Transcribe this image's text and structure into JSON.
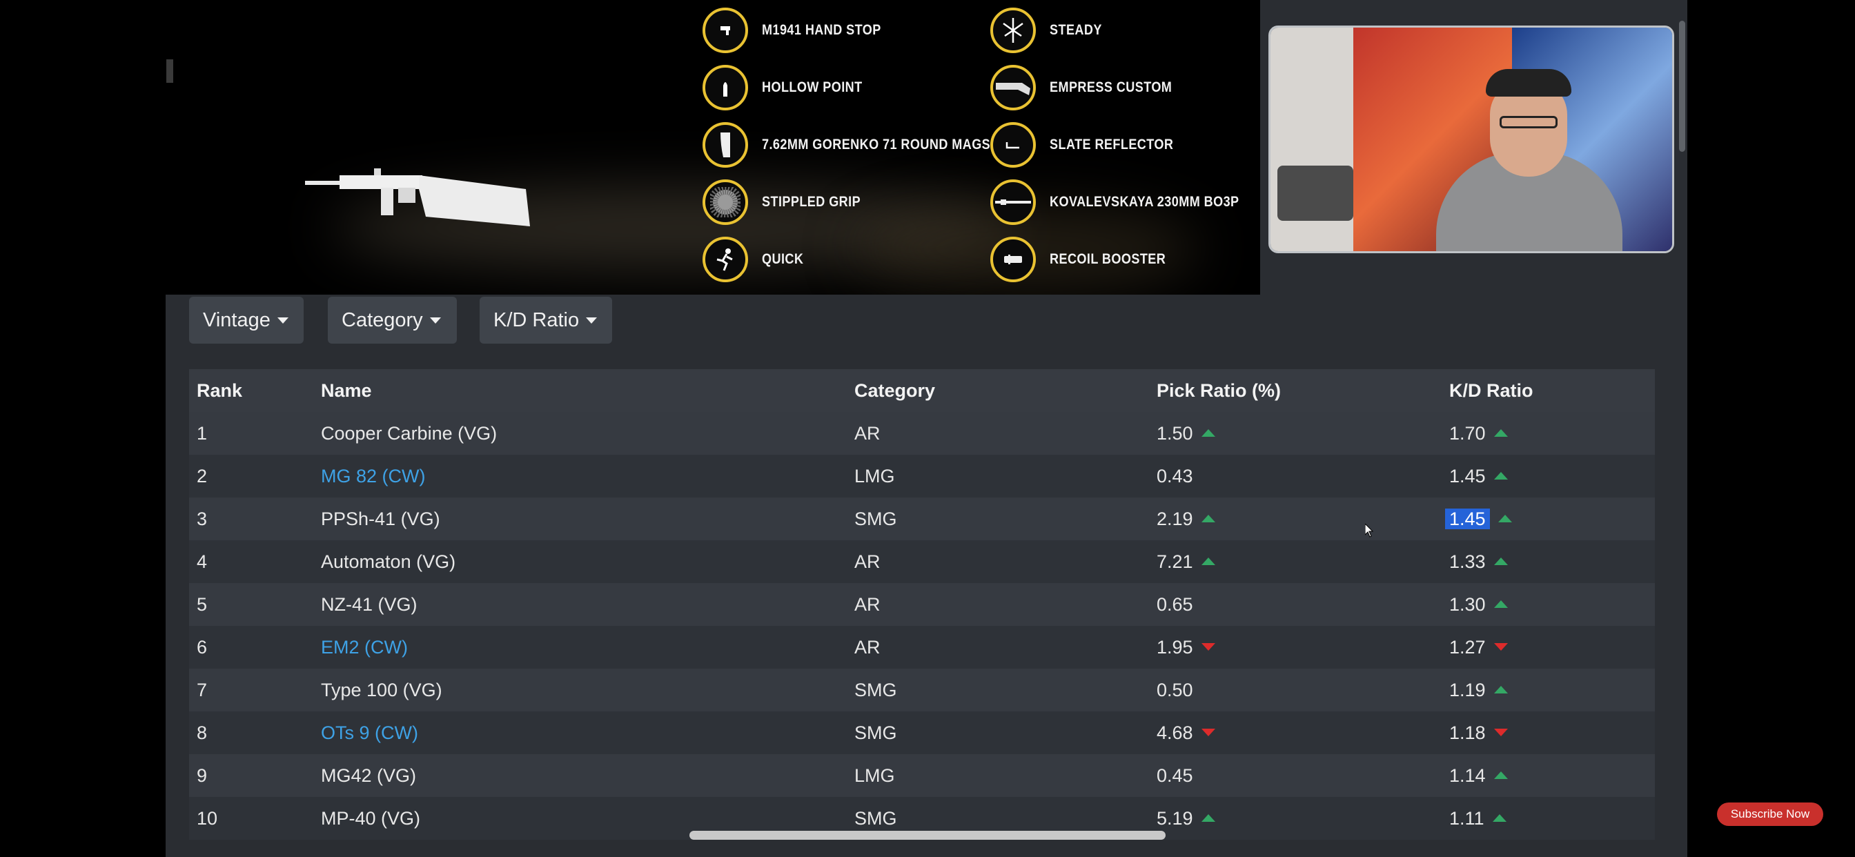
{
  "attachments_left": [
    {
      "name": "M1941 HAND STOP",
      "icon": "hand-stop-icon"
    },
    {
      "name": "HOLLOW POINT",
      "icon": "bullet-icon"
    },
    {
      "name": "7.62MM GORENKO 71 ROUND MAGS",
      "icon": "magazine-icon"
    },
    {
      "name": "STIPPLED GRIP",
      "icon": "grip-icon"
    },
    {
      "name": "QUICK",
      "icon": "runner-icon"
    }
  ],
  "attachments_right": [
    {
      "name": "STEADY",
      "icon": "steady-icon"
    },
    {
      "name": "EMPRESS CUSTOM",
      "icon": "stock-icon"
    },
    {
      "name": "SLATE REFLECTOR",
      "icon": "optic-icon"
    },
    {
      "name": "KOVALEVSKAYA 230MM BO3P",
      "icon": "barrel-icon"
    },
    {
      "name": "RECOIL BOOSTER",
      "icon": "recoil-icon"
    }
  ],
  "filters": {
    "vintage": "Vintage",
    "category": "Category",
    "kd": "K/D Ratio"
  },
  "table": {
    "headers": {
      "rank": "Rank",
      "name": "Name",
      "category": "Category",
      "pick": "Pick Ratio (%)",
      "kd": "K/D Ratio"
    },
    "rows": [
      {
        "rank": "1",
        "name": "Cooper Carbine (VG)",
        "link": false,
        "category": "AR",
        "pick": "1.50",
        "pick_trend": "up",
        "kd": "1.70",
        "kd_trend": "up"
      },
      {
        "rank": "2",
        "name": "MG 82 (CW)",
        "link": true,
        "category": "LMG",
        "pick": "0.43",
        "pick_trend": "none",
        "kd": "1.45",
        "kd_trend": "up"
      },
      {
        "rank": "3",
        "name": "PPSh-41 (VG)",
        "link": false,
        "category": "SMG",
        "pick": "2.19",
        "pick_trend": "up",
        "kd": "1.45",
        "kd_trend": "up",
        "selected": true
      },
      {
        "rank": "4",
        "name": "Automaton (VG)",
        "link": false,
        "category": "AR",
        "pick": "7.21",
        "pick_trend": "up",
        "kd": "1.33",
        "kd_trend": "up"
      },
      {
        "rank": "5",
        "name": "NZ-41 (VG)",
        "link": false,
        "category": "AR",
        "pick": "0.65",
        "pick_trend": "none",
        "kd": "1.30",
        "kd_trend": "up"
      },
      {
        "rank": "6",
        "name": "EM2 (CW)",
        "link": true,
        "category": "AR",
        "pick": "1.95",
        "pick_trend": "down",
        "kd": "1.27",
        "kd_trend": "down"
      },
      {
        "rank": "7",
        "name": "Type 100 (VG)",
        "link": false,
        "category": "SMG",
        "pick": "0.50",
        "pick_trend": "none",
        "kd": "1.19",
        "kd_trend": "up"
      },
      {
        "rank": "8",
        "name": "OTs 9 (CW)",
        "link": true,
        "category": "SMG",
        "pick": "4.68",
        "pick_trend": "down",
        "kd": "1.18",
        "kd_trend": "down"
      },
      {
        "rank": "9",
        "name": "MG42 (VG)",
        "link": false,
        "category": "LMG",
        "pick": "0.45",
        "pick_trend": "none",
        "kd": "1.14",
        "kd_trend": "up"
      },
      {
        "rank": "10",
        "name": "MP-40 (VG)",
        "link": false,
        "category": "SMG",
        "pick": "5.19",
        "pick_trend": "up",
        "kd": "1.11",
        "kd_trend": "up"
      }
    ]
  },
  "subscribe": "Subscribe Now",
  "colors": {
    "accent_gold": "#e9c232",
    "up": "#34a865",
    "down": "#dd2b2b",
    "link": "#3ea2e6",
    "row_odd": "#2e3238",
    "row_even": "#363a41",
    "header": "#373b42"
  }
}
